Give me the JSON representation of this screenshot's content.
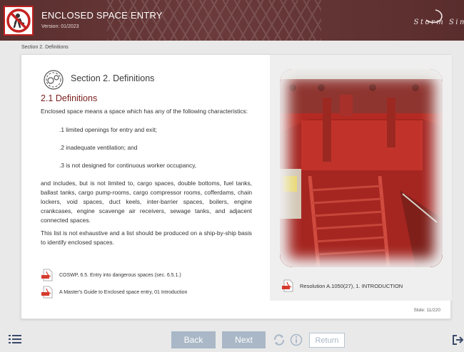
{
  "header": {
    "title": "ENCLOSED SPACE ENTRY",
    "version": "Version: 01/2023",
    "brand": "Storm Sim",
    "logo_icon": "no-entry-person-icon"
  },
  "breadcrumb": "Section 2. Definitions",
  "content": {
    "section_heading": "Section 2. Definitions",
    "subheading": "2.1 Definitions",
    "intro": "Enclosed space means a space which has any of the following characteristics:",
    "items": [
      ".1 limited openings for entry and exit;",
      ".2 inadequate ventilation; and",
      ".3 is not designed for continuous worker occupancy,"
    ],
    "paragraph": "and includes, but is not limited to, cargo spaces, double bottoms, fuel tanks, ballast tanks, cargo pump-rooms, cargo compressor rooms, cofferdams, chain lockers, void spaces, duct keels, inter-barrier spaces, boilers, engine crankcases, engine scavenge air receivers, sewage tanks, and adjacent connected spaces.",
    "note": "This list is not exhaustive and a list should be produced on a ship-by-ship basis to identify enclosed spaces.",
    "references": [
      "COSWP, 6.5. Entry into dangerous spaces (sec. 6.5.1.)",
      "A Master's Guide to Enclosed space entry, 01 Introduction"
    ],
    "resolution_ref": "Resolution A.1050(27), 1. INTRODUCTION",
    "slide": "Slide: 11/220"
  },
  "footer": {
    "back": "Back",
    "next": "Next",
    "return": "Return"
  },
  "colors": {
    "header_bg": "#5a2f2f",
    "subheading": "#7a1d1d",
    "nav_button": "#a9b7c6",
    "tank_red": "#b42a22"
  }
}
